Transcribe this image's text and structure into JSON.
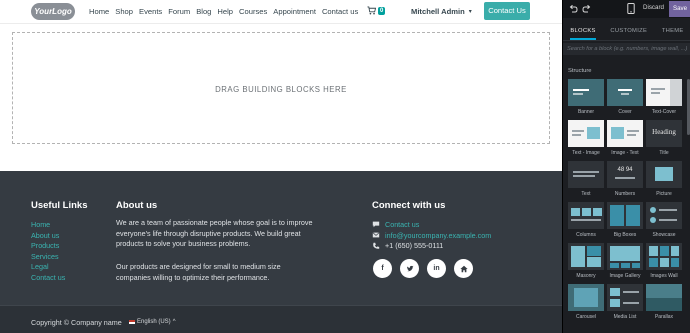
{
  "nav": {
    "logo": "YourLogo",
    "links": [
      "Home",
      "Shop",
      "Events",
      "Forum",
      "Blog",
      "Help",
      "Courses",
      "Appointment",
      "Contact us"
    ],
    "cart_count": "0",
    "user": "Mitchell Admin",
    "contact_button": "Contact Us"
  },
  "dropzone": {
    "text": "DRAG BUILDING BLOCKS HERE"
  },
  "footer": {
    "useful_links_title": "Useful Links",
    "useful_links": [
      "Home",
      "About us",
      "Products",
      "Services",
      "Legal",
      "Contact us"
    ],
    "about_title": "About us",
    "about_p1": "We are a team of passionate people whose goal is to improve everyone's life through disruptive products. We build great products to solve your business problems.",
    "about_p2": "Our products are designed for small to medium size companies willing to optimize their performance.",
    "connect_title": "Connect with us",
    "contact_us": "Contact us",
    "email": "info@yourcompany.example.com",
    "phone": "+1 (650) 555-0111",
    "socials": [
      "facebook-icon",
      "twitter-icon",
      "linkedin-icon",
      "home-icon"
    ],
    "copyright": "Copyright © Company name",
    "language": "English (US)"
  },
  "editor": {
    "discard": "Discard",
    "save": "Save",
    "tabs": [
      "BLOCKS",
      "CUSTOMIZE",
      "THEME"
    ],
    "search_placeholder": "Search for a block (e.g. numbers, image wall, ...)",
    "section": "Structure",
    "blocks": [
      "Banner",
      "Cover",
      "Text-Cover",
      "Text - Image",
      "Image - Text",
      "Title",
      "Text",
      "Numbers",
      "Picture",
      "Columns",
      "Big Boxes",
      "Showcase",
      "Masonry",
      "Image Gallery",
      "Images Wall",
      "Carousel",
      "Media List",
      "Parallax"
    ],
    "accent_color": "#71639e",
    "primary_color": "#3aadaa"
  }
}
